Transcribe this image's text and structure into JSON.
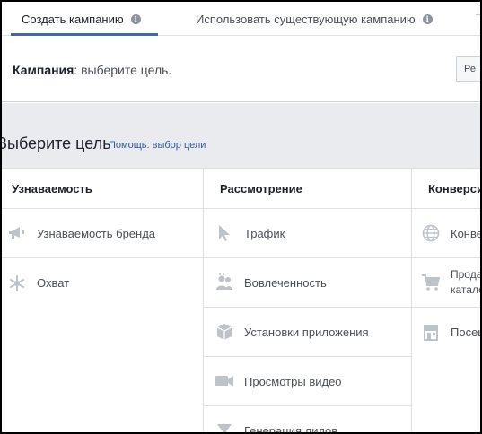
{
  "tabs": [
    {
      "label": "Создать кампанию",
      "active": true
    },
    {
      "label": "Использовать существующую кампанию",
      "active": false
    }
  ],
  "campaign": {
    "label": "Кампания",
    "text": ": выберите цель.",
    "edit_button": "Ре"
  },
  "goal": {
    "title": "Выберите цель",
    "help_link": "Помощь: выбор цели"
  },
  "columns": [
    {
      "header": "Узнаваемость",
      "items": [
        {
          "label": "Узнаваемость бренда",
          "icon": "megaphone-icon"
        },
        {
          "label": "Охват",
          "icon": "reach-icon"
        }
      ]
    },
    {
      "header": "Рассмотрение",
      "items": [
        {
          "label": "Трафик",
          "icon": "cursor-icon"
        },
        {
          "label": "Вовлеченность",
          "icon": "people-icon"
        },
        {
          "label": "Установки приложения",
          "icon": "box-icon"
        },
        {
          "label": "Просмотры видео",
          "icon": "video-icon"
        },
        {
          "label": "Генерация лидов",
          "icon": "funnel-icon"
        }
      ]
    },
    {
      "header": "Конверси",
      "items": [
        {
          "label": "Конве",
          "icon": "globe-icon"
        },
        {
          "label": "Прода",
          "label2": "катало",
          "icon": "cart-icon"
        },
        {
          "label": "Посещ",
          "icon": "store-icon"
        }
      ]
    }
  ],
  "colors": {
    "accent": "#4267b2",
    "link": "#365899",
    "icon": "#bec3c9",
    "gray_bg": "#e9ebee"
  }
}
